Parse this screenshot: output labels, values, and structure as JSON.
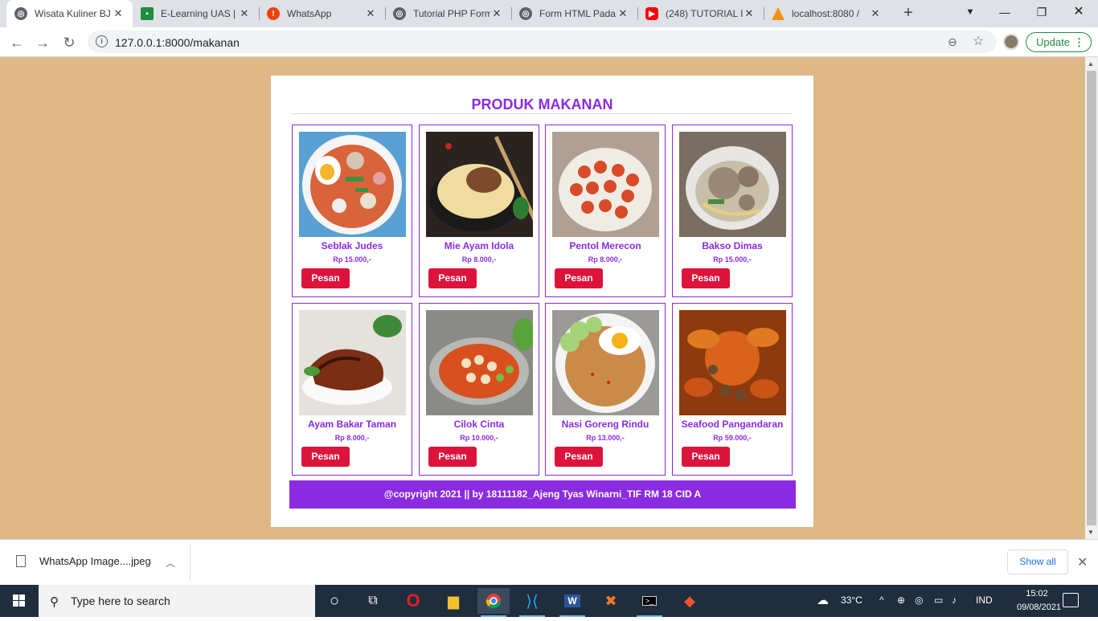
{
  "tabs": [
    {
      "title": "Wisata Kuliner BJ",
      "icon": "globe-icon",
      "color": "#5f6368"
    },
    {
      "title": "E-Learning UAS |",
      "icon": "classroom-icon",
      "color": "#1e8e3e"
    },
    {
      "title": "WhatsApp",
      "icon": "alert-icon",
      "color": "#e8430f"
    },
    {
      "title": "Tutorial PHP Form",
      "icon": "globe-icon",
      "color": "#5f6368"
    },
    {
      "title": "Form HTML Pada",
      "icon": "globe-icon",
      "color": "#5f6368"
    },
    {
      "title": "(248) TUTORIAL I",
      "icon": "youtube-icon",
      "color": "#ff0000"
    },
    {
      "title": "localhost:8080 /",
      "icon": "phpmyadmin-icon",
      "color": "#f29111"
    }
  ],
  "toolbar": {
    "url": "127.0.0.1:8000/makanan",
    "update_label": "Update"
  },
  "page": {
    "title": "PRODUK MAKANAN",
    "button_label": "Pesan",
    "products": [
      {
        "name": "Seblak Judes",
        "price": "Rp 15.000,-"
      },
      {
        "name": "Mie Ayam Idola",
        "price": "Rp 8.000,-"
      },
      {
        "name": "Pentol Merecon",
        "price": "Rp 8.000,-"
      },
      {
        "name": "Bakso Dimas",
        "price": "Rp 15.000,-"
      },
      {
        "name": "Ayam Bakar Taman",
        "price": "Rp 8.000,-"
      },
      {
        "name": "Cilok Cinta",
        "price": "Rp 10.000,-"
      },
      {
        "name": "Nasi Goreng Rindu",
        "price": "Rp 13.000,-"
      },
      {
        "name": "Seafood Pangandaran",
        "price": "Rp 59.000,-"
      }
    ],
    "footer": "@copyright 2021 || by 18111182_Ajeng Tyas Winarni_TIF RM 18 CID A"
  },
  "downloads": {
    "file": "WhatsApp Image....jpeg",
    "show_all": "Show all"
  },
  "taskbar": {
    "search_placeholder": "Type here to search",
    "temperature": "33°C",
    "language": "IND",
    "time": "15:02",
    "date": "09/08/2021"
  },
  "colors": {
    "page_bg": "#deb887",
    "accent": "#8a2be2",
    "button": "#dc143c"
  }
}
